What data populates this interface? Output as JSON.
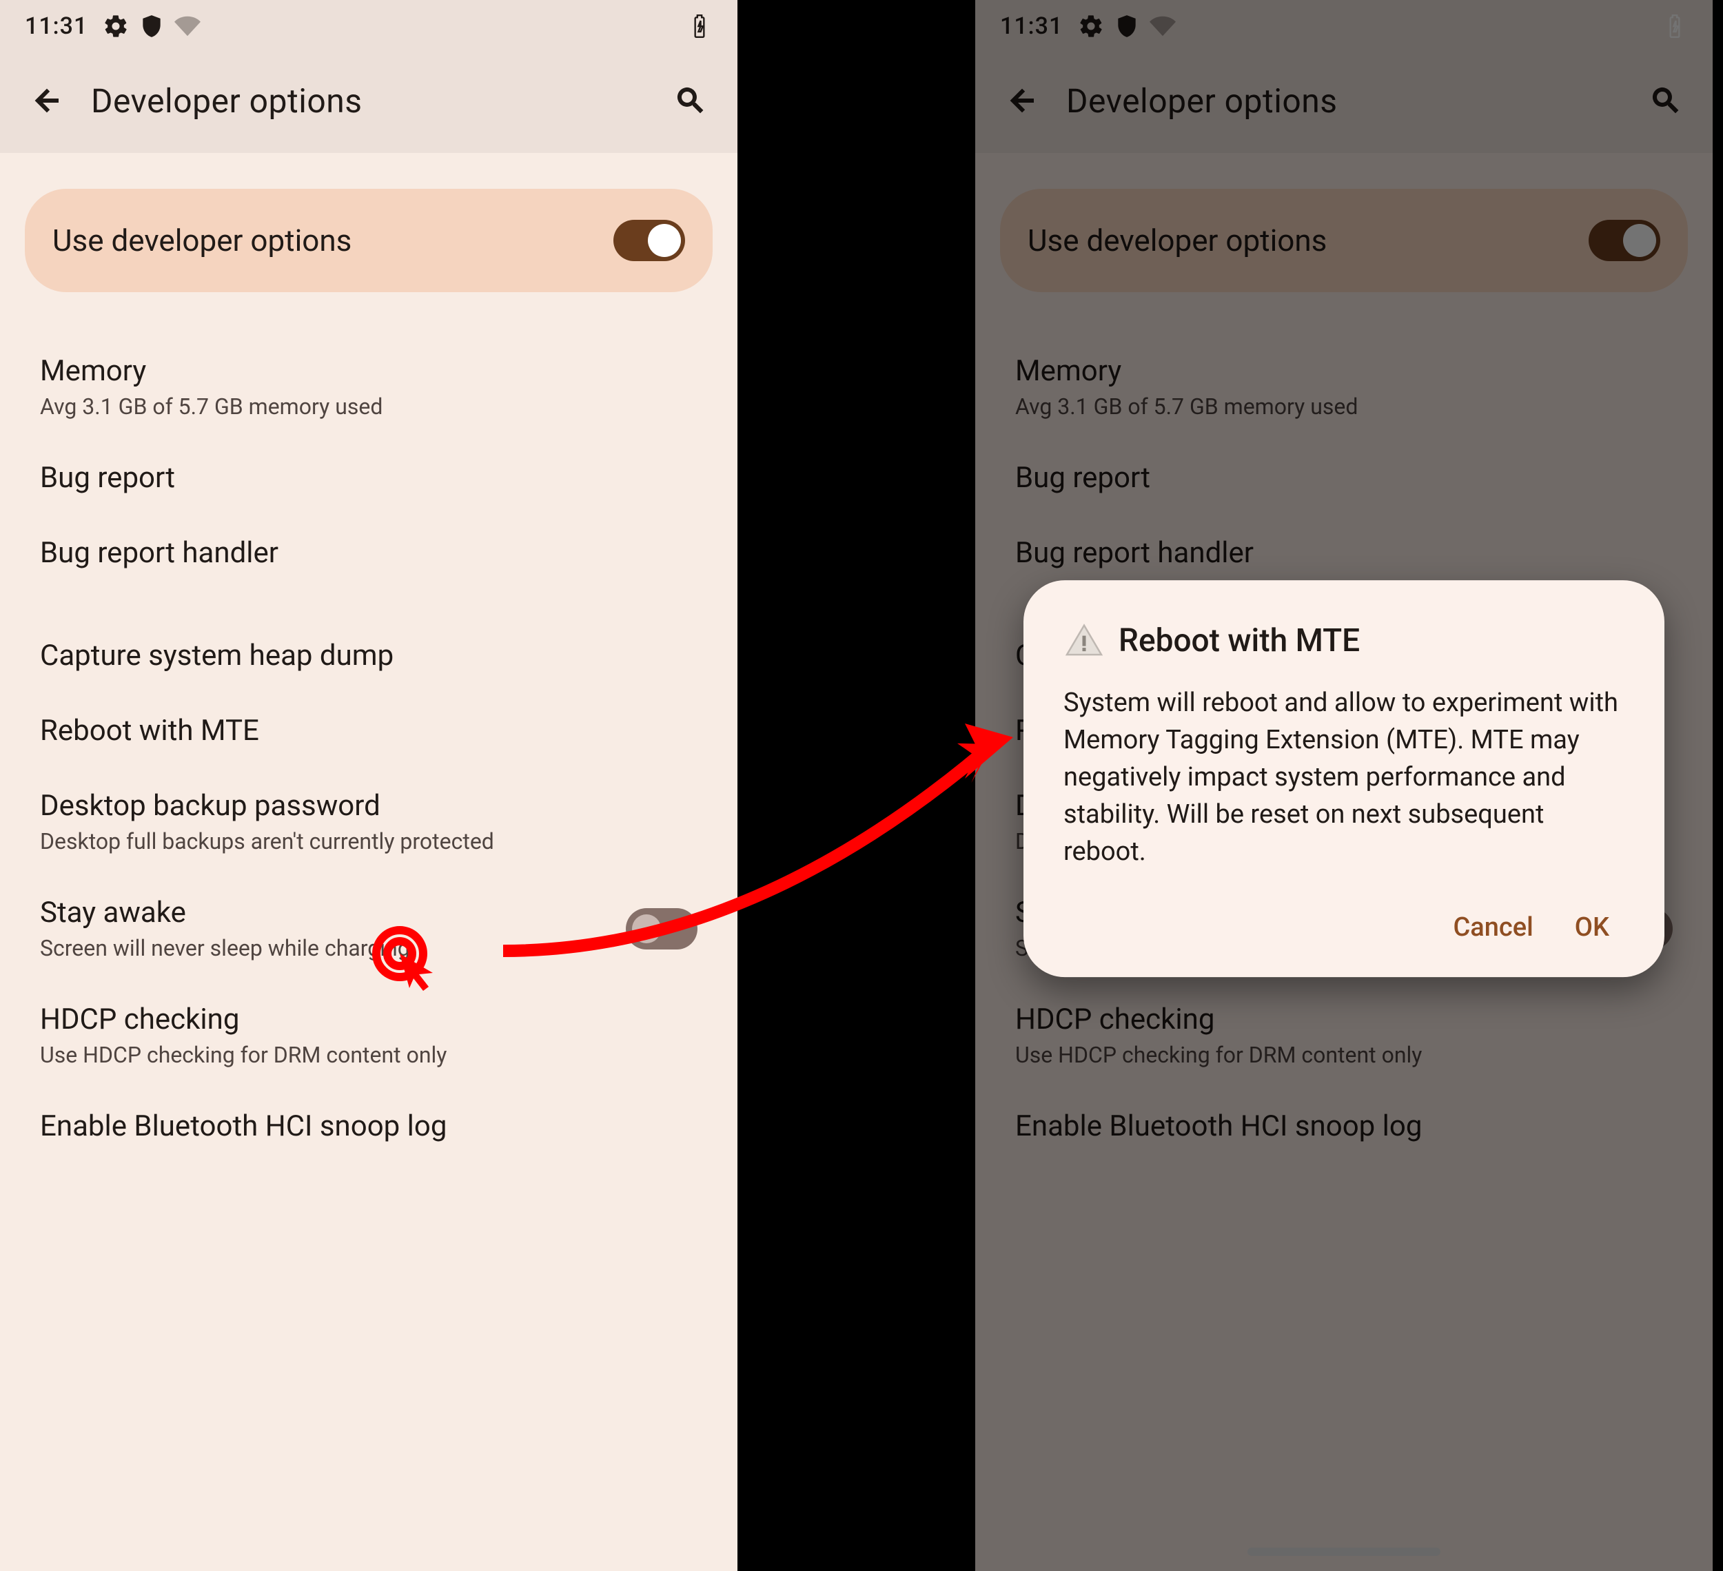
{
  "status": {
    "time": "11:31"
  },
  "appbar": {
    "title": "Developer options"
  },
  "master": {
    "label": "Use developer options"
  },
  "settings": {
    "memory": {
      "title": "Memory",
      "sub": "Avg 3.1 GB of 5.7 GB memory used"
    },
    "bugreport": {
      "title": "Bug report"
    },
    "bugreporthandler": {
      "title": "Bug report handler"
    },
    "heapdump": {
      "title": "Capture system heap dump"
    },
    "mte": {
      "title": "Reboot with MTE"
    },
    "desktopbackup": {
      "title": "Desktop backup password",
      "sub": "Desktop full backups aren't currently protected"
    },
    "stayawake": {
      "title": "Stay awake",
      "sub": "Screen will never sleep while charging"
    },
    "hdcp": {
      "title": "HDCP checking",
      "sub": "Use HDCP checking for DRM content only"
    },
    "btsnoop": {
      "title": "Enable Bluetooth HCI snoop log"
    }
  },
  "dialog": {
    "title": "Reboot with MTE",
    "body": "System will reboot and allow to experiment with Memory Tagging Extension (MTE). MTE may negatively impact system performance and stability. Will be reset on next subsequent reboot.",
    "cancel": "Cancel",
    "ok": "OK"
  }
}
